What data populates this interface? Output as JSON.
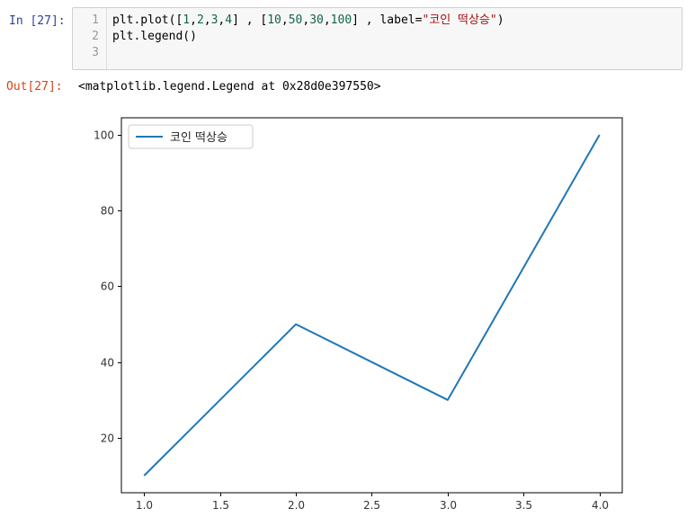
{
  "cell": {
    "in_prompt": "In [27]:",
    "out_prompt": "Out[27]:",
    "line_numbers": [
      "1",
      "2",
      "3"
    ],
    "code": {
      "line1": {
        "p1": "plt.plot([",
        "n1": "1",
        "p2": ",",
        "n2": "2",
        "p3": ",",
        "n3": "3",
        "p4": ",",
        "n4": "4",
        "p5": "] , [",
        "n5": "10",
        "p6": ",",
        "n6": "50",
        "p7": ",",
        "n7": "30",
        "p8": ",",
        "n8": "100",
        "p9": "] , label=",
        "s1": "\"코인 떡상승\"",
        "p10": ")"
      },
      "line2": "plt.legend()",
      "line3": ""
    },
    "output": "<matplotlib.legend.Legend at 0x28d0e397550>"
  },
  "chart_data": {
    "type": "line",
    "x": [
      1.0,
      2.0,
      3.0,
      4.0
    ],
    "series": [
      {
        "name": "코인 떡상승",
        "values": [
          10,
          50,
          30,
          100
        ],
        "color": "#1f77b4"
      }
    ],
    "xlim": [
      0.85,
      4.15
    ],
    "ylim": [
      5.5,
      104.5
    ],
    "x_ticks": [
      1.0,
      1.5,
      2.0,
      2.5,
      3.0,
      3.5,
      4.0
    ],
    "x_tick_labels": [
      "1.0",
      "1.5",
      "2.0",
      "2.5",
      "3.0",
      "3.5",
      "4.0"
    ],
    "y_ticks": [
      20,
      40,
      60,
      80,
      100
    ],
    "y_tick_labels": [
      "20",
      "40",
      "60",
      "80",
      "100"
    ],
    "legend_position": "upper-left",
    "grid": false
  }
}
